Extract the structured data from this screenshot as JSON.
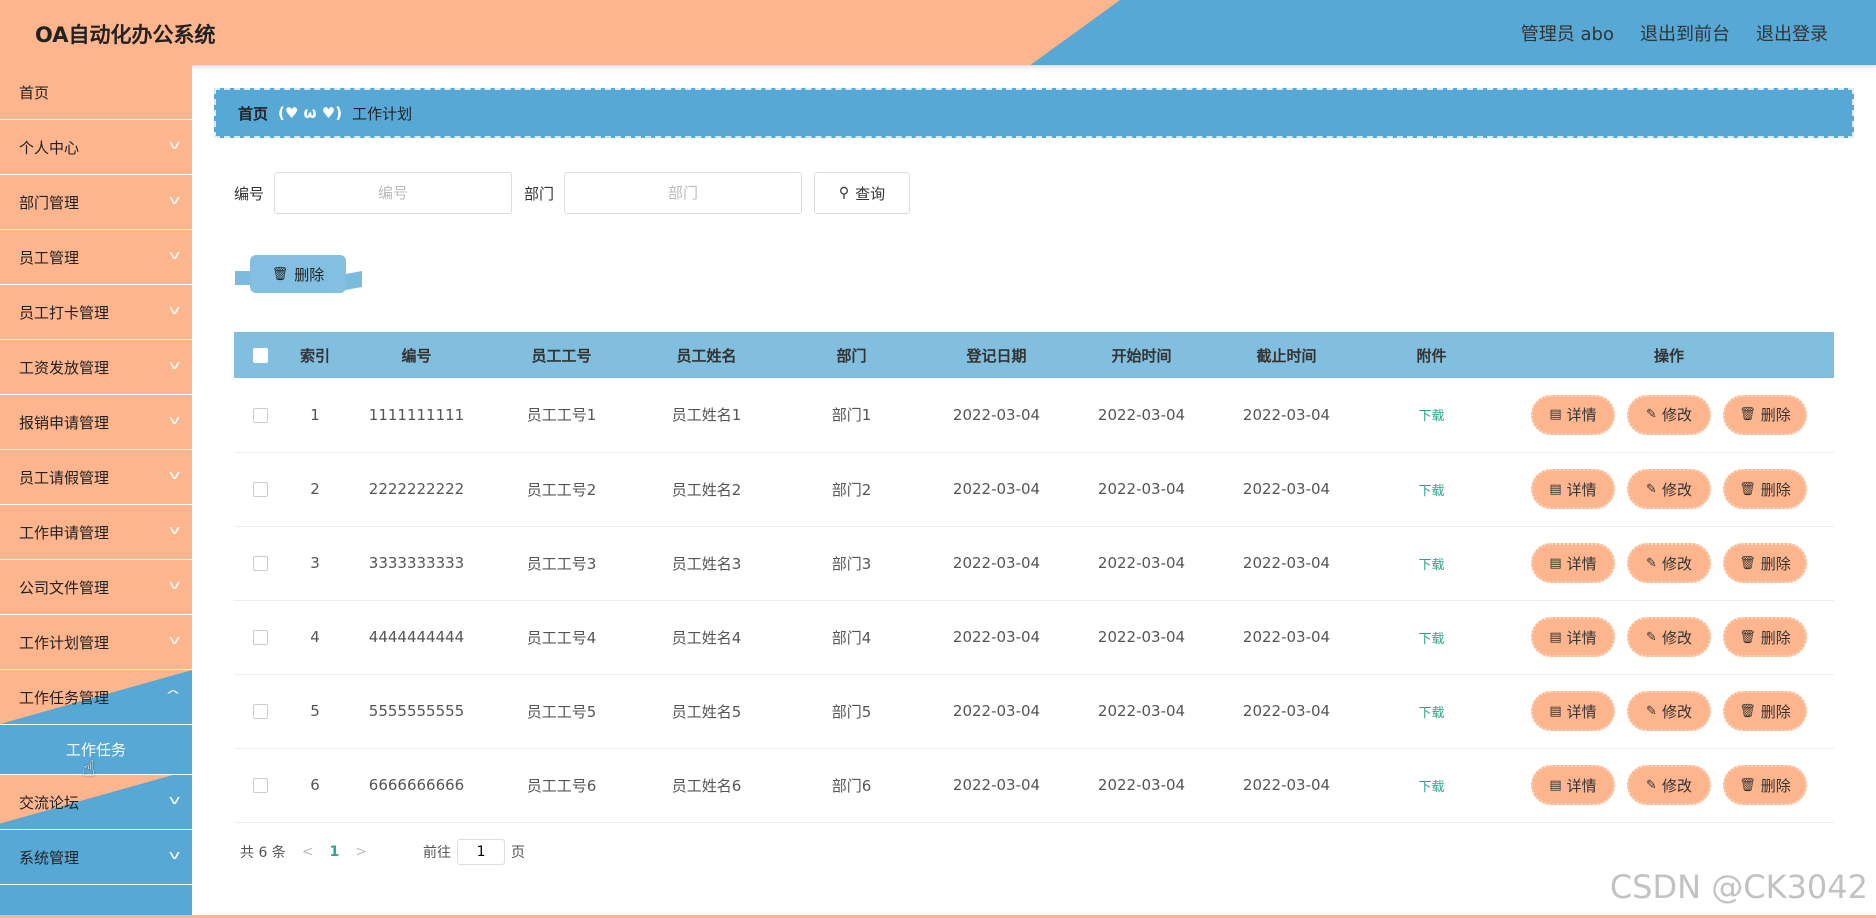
{
  "app": {
    "title": "OA自动化办公系统",
    "user_label": "管理员 abo",
    "exit_front": "退出到前台",
    "logout": "退出登录"
  },
  "sidebar": {
    "items": [
      {
        "label": "首页"
      },
      {
        "label": "个人中心"
      },
      {
        "label": "部门管理"
      },
      {
        "label": "员工管理"
      },
      {
        "label": "员工打卡管理"
      },
      {
        "label": "工资发放管理"
      },
      {
        "label": "报销申请管理"
      },
      {
        "label": "员工请假管理"
      },
      {
        "label": "工作申请管理"
      },
      {
        "label": "公司文件管理"
      },
      {
        "label": "工作计划管理"
      },
      {
        "label": "工作任务管理"
      }
    ],
    "submenu_label": "工作任务",
    "after_items": [
      {
        "label": "交流论坛"
      },
      {
        "label": "系统管理"
      }
    ]
  },
  "breadcrumb": {
    "home": "首页",
    "separator": "(♥ ω ♥)",
    "current": "工作计划"
  },
  "search": {
    "id_label": "编号",
    "id_placeholder": "编号",
    "dept_label": "部门",
    "dept_placeholder": "部门",
    "query_label": "查询"
  },
  "toolbar": {
    "delete_label": "删除"
  },
  "table": {
    "headers": [
      "索引",
      "编号",
      "员工工号",
      "员工姓名",
      "部门",
      "登记日期",
      "开始时间",
      "截止时间",
      "附件",
      "操作"
    ],
    "download_label": "下载",
    "detail_label": "详情",
    "edit_label": "修改",
    "delete_label": "删除",
    "rows": [
      {
        "index": "1",
        "id": "1111111111",
        "emp_no": "员工工号1",
        "emp_name": "员工姓名1",
        "dept": "部门1",
        "reg_date": "2022-03-04",
        "start": "2022-03-04",
        "end": "2022-03-04"
      },
      {
        "index": "2",
        "id": "2222222222",
        "emp_no": "员工工号2",
        "emp_name": "员工姓名2",
        "dept": "部门2",
        "reg_date": "2022-03-04",
        "start": "2022-03-04",
        "end": "2022-03-04"
      },
      {
        "index": "3",
        "id": "3333333333",
        "emp_no": "员工工号3",
        "emp_name": "员工姓名3",
        "dept": "部门3",
        "reg_date": "2022-03-04",
        "start": "2022-03-04",
        "end": "2022-03-04"
      },
      {
        "index": "4",
        "id": "4444444444",
        "emp_no": "员工工号4",
        "emp_name": "员工姓名4",
        "dept": "部门4",
        "reg_date": "2022-03-04",
        "start": "2022-03-04",
        "end": "2022-03-04"
      },
      {
        "index": "5",
        "id": "5555555555",
        "emp_no": "员工工号5",
        "emp_name": "员工姓名5",
        "dept": "部门5",
        "reg_date": "2022-03-04",
        "start": "2022-03-04",
        "end": "2022-03-04"
      },
      {
        "index": "6",
        "id": "6666666666",
        "emp_no": "员工工号6",
        "emp_name": "员工姓名6",
        "dept": "部门6",
        "reg_date": "2022-03-04",
        "start": "2022-03-04",
        "end": "2022-03-04"
      }
    ]
  },
  "pagination": {
    "total": "共 6 条",
    "current_page": "1",
    "goto_label": "前往",
    "goto_value": "1",
    "page_suffix": "页"
  },
  "watermark": "CSDN @CK3042",
  "colors": {
    "peach": "#fdb58e",
    "blue": "#58a8d6",
    "light_blue": "#82bede",
    "green": "#2aa68a"
  }
}
